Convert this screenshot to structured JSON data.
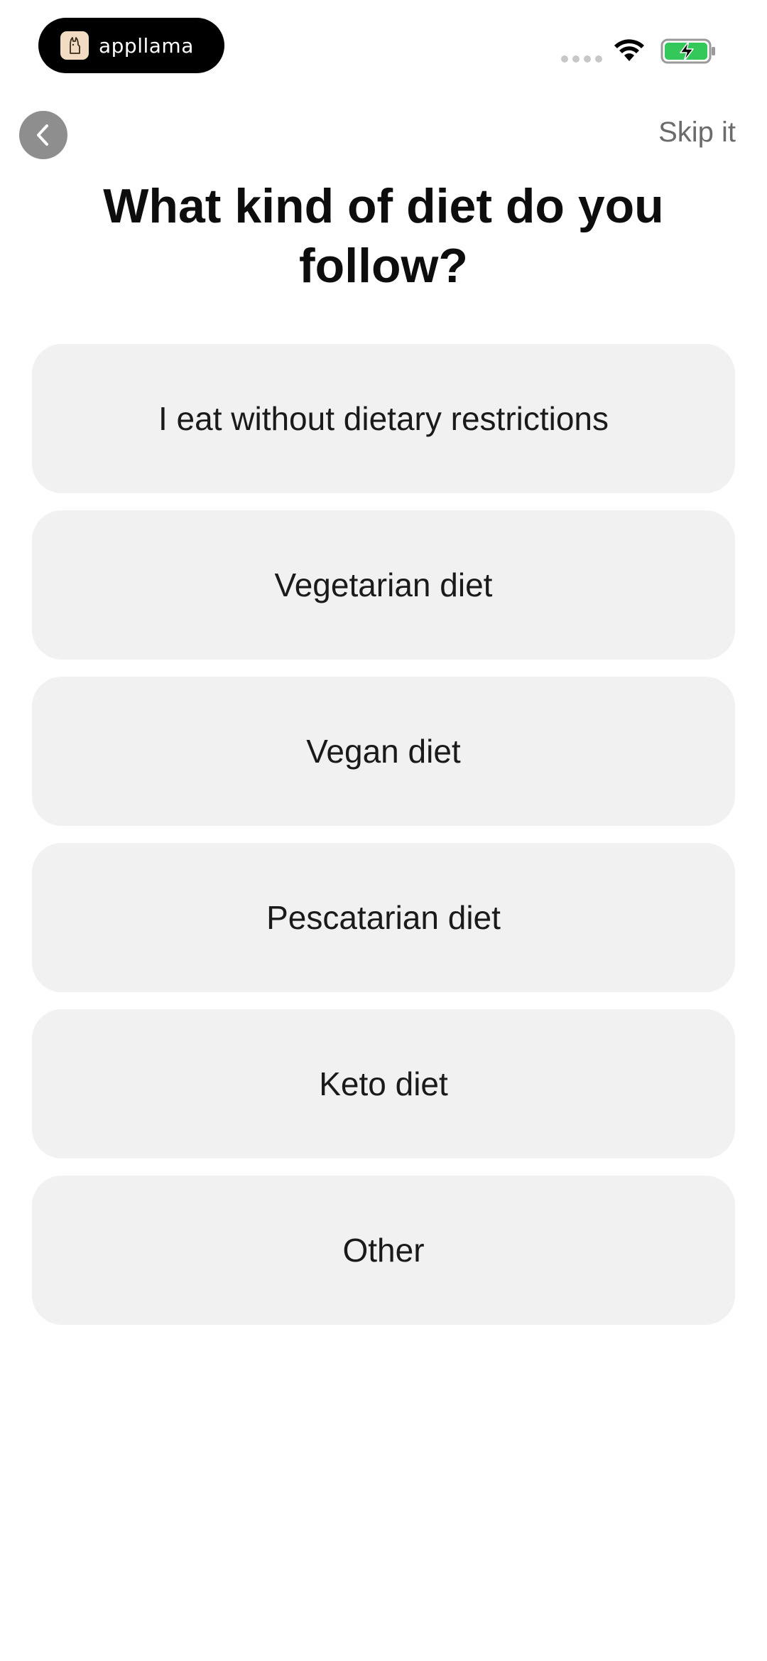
{
  "status_bar": {
    "brand_name": "appllama",
    "icons": [
      "llama-logo-icon",
      "signal-icon",
      "wifi-icon",
      "battery-charging-icon"
    ],
    "battery_color": "#34c759"
  },
  "nav": {
    "back_icon": "chevron-left-icon",
    "skip_label": "Skip it"
  },
  "title": "What kind of diet do you follow?",
  "options": [
    {
      "label": "I eat without dietary restrictions"
    },
    {
      "label": "Vegetarian diet"
    },
    {
      "label": "Vegan diet"
    },
    {
      "label": "Pescatarian diet"
    },
    {
      "label": "Keto diet"
    },
    {
      "label": "Other"
    }
  ],
  "colors": {
    "option_background": "#f1f1f1",
    "back_button": "#8e8e8e",
    "skip_text": "#6b6b6b"
  }
}
